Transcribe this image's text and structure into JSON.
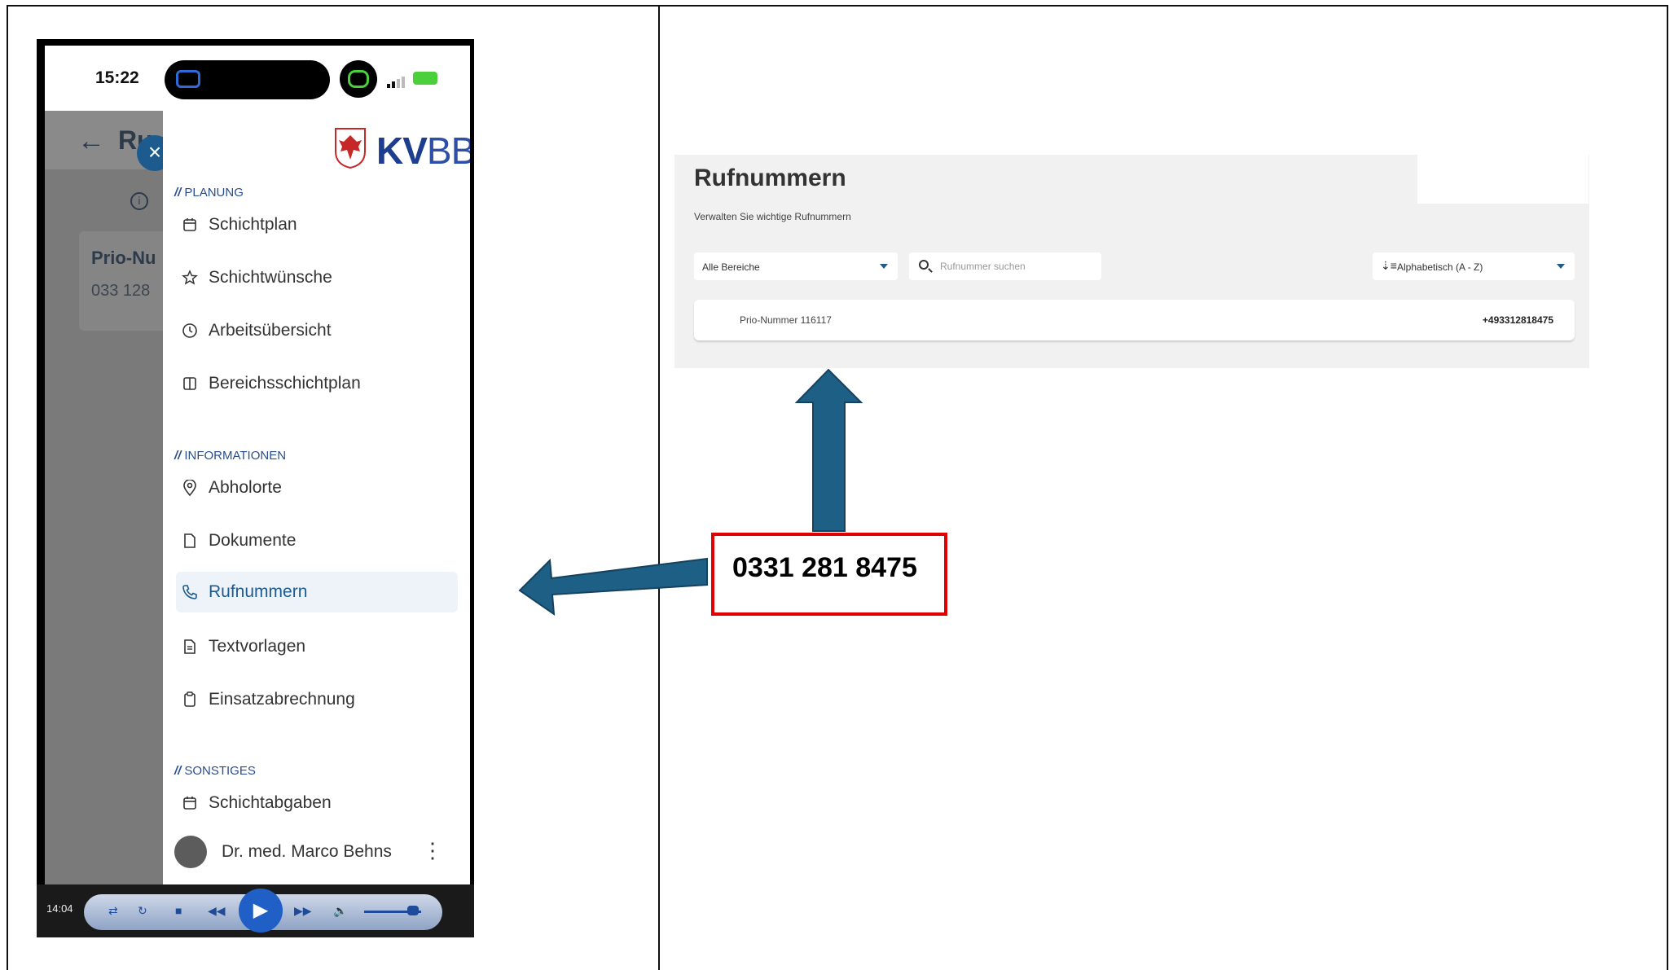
{
  "phone": {
    "status_time": "15:22",
    "logo_text_kv": "KV",
    "logo_text_bb": "BB",
    "behind_title": "Ru",
    "behind_card_title": "Prio-Nu",
    "behind_card_number": "033 128",
    "sections": [
      {
        "label": "PLANUNG",
        "items": [
          "Schichtplan",
          "Schichtwünsche",
          "Arbeitsübersicht",
          "Bereichsschichtplan"
        ]
      },
      {
        "label": "INFORMATIONEN",
        "items": [
          "Abholorte",
          "Dokumente",
          "Rufnummern",
          "Textvorlagen",
          "Einsatzabrechnung"
        ]
      },
      {
        "label": "SONSTIGES",
        "items": [
          "Schichtabgaben"
        ]
      }
    ],
    "active_item": "Rufnummern",
    "user_name": "Dr. med. Marco Behns",
    "player_time": "14:04"
  },
  "web": {
    "title": "Rufnummern",
    "subtitle": "Verwalten Sie wichtige Rufnummern",
    "filter_value": "Alle Bereiche",
    "search_placeholder": "Rufnummer suchen",
    "sort_value": "Alphabetisch (A - Z)",
    "rows": [
      {
        "name": "Prio-Nummer 116117",
        "number": "+493312818475"
      }
    ]
  },
  "callout": {
    "text": "0331 281 8475",
    "border_color": "#e00000"
  },
  "colors": {
    "arrow_fill": "#1e5f86",
    "brand_blue": "#1d5b8f"
  }
}
